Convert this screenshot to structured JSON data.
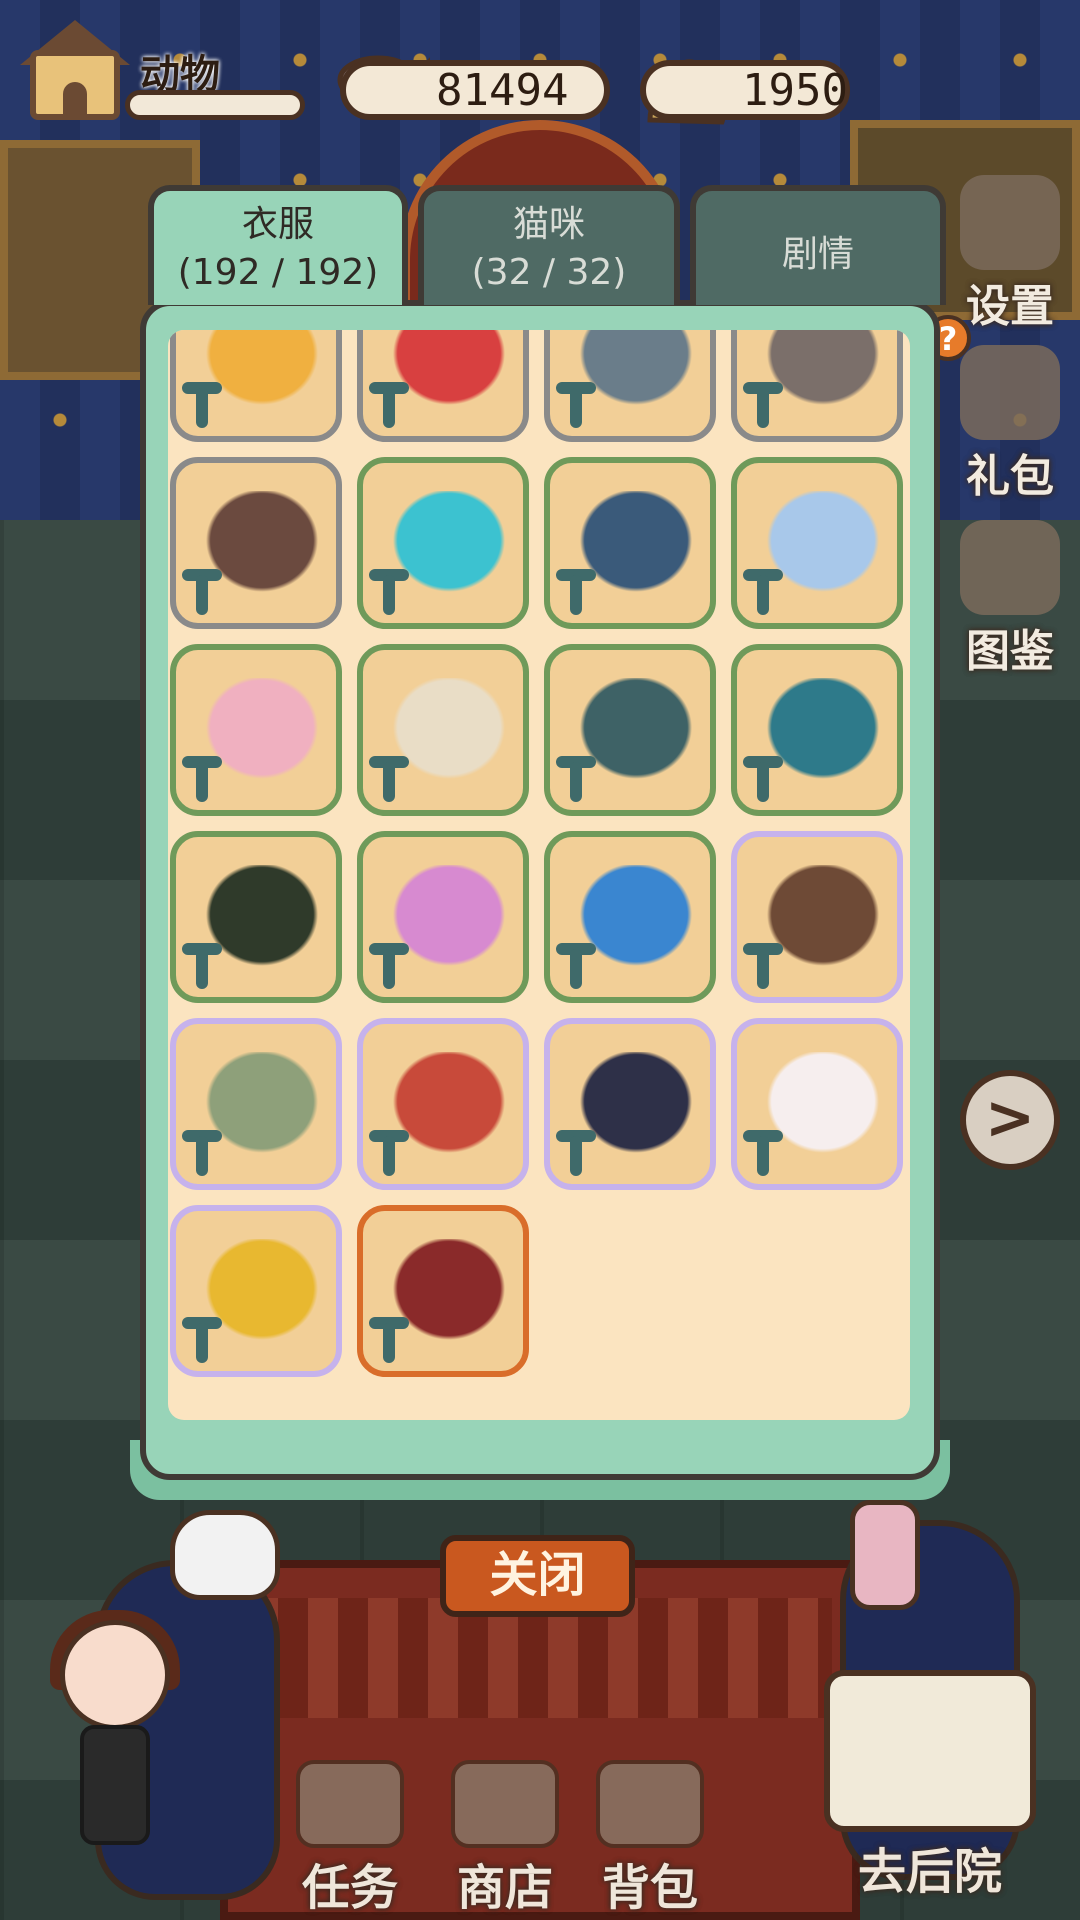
{
  "hud": {
    "home_label": "动物",
    "home_progress": 0.0,
    "fish_count": "81494",
    "coin_count": "1950"
  },
  "side_buttons": {
    "settings": "设置",
    "gift": "礼包",
    "guide": "图鉴",
    "help": "?",
    "next": ">"
  },
  "tabs": [
    {
      "label": "衣服",
      "count": "(192 / 192)"
    },
    {
      "label": "猫咪",
      "count": "(32 / 32)"
    },
    {
      "label": "剧情",
      "count": ""
    }
  ],
  "items": [
    {
      "name": "crown-outfit",
      "rarity": "gray",
      "color": "#f0b040"
    },
    {
      "name": "santa-outfit",
      "rarity": "gray",
      "color": "#d84040"
    },
    {
      "name": "helmet-outfit",
      "rarity": "gray",
      "color": "#6a7d8a"
    },
    {
      "name": "witch-hat-outfit",
      "rarity": "gray",
      "color": "#7b6f6a"
    },
    {
      "name": "cowboy-hat-outfit",
      "rarity": "gray",
      "color": "#6b4a3f"
    },
    {
      "name": "cyan-dress-outfit",
      "rarity": "green",
      "color": "#3cc2d0"
    },
    {
      "name": "navy-uniform-outfit",
      "rarity": "green",
      "color": "#3a5a7a"
    },
    {
      "name": "light-blue-outfit",
      "rarity": "green",
      "color": "#a8c8ea"
    },
    {
      "name": "pink-polka-outfit",
      "rarity": "green",
      "color": "#f0b0c0"
    },
    {
      "name": "cream-outfit",
      "rarity": "green",
      "color": "#e9ddc6"
    },
    {
      "name": "military-outfit",
      "rarity": "green",
      "color": "#3e6266"
    },
    {
      "name": "teal-jacket-outfit",
      "rarity": "green",
      "color": "#2e7a8a"
    },
    {
      "name": "striped-pants-outfit",
      "rarity": "green",
      "color": "#2f3a2a"
    },
    {
      "name": "pink-skirt-outfit",
      "rarity": "green",
      "color": "#d78ad0"
    },
    {
      "name": "blue-boots-outfit",
      "rarity": "green",
      "color": "#3a86d0"
    },
    {
      "name": "brown-cape-outfit",
      "rarity": "purple",
      "color": "#6e4a36"
    },
    {
      "name": "green-frill-outfit",
      "rarity": "purple",
      "color": "#8ea07a"
    },
    {
      "name": "red-coat-outfit",
      "rarity": "purple",
      "color": "#c84a3a"
    },
    {
      "name": "dark-armor-outfit",
      "rarity": "purple",
      "color": "#2e3048"
    },
    {
      "name": "white-tiara-outfit",
      "rarity": "purple",
      "color": "#f6eeee"
    },
    {
      "name": "yellow-horn-outfit",
      "rarity": "purple",
      "color": "#e8b830"
    },
    {
      "name": "royal-red-outfit",
      "rarity": "orange",
      "color": "#8a2a2a"
    }
  ],
  "close_label": "关闭",
  "nav": {
    "task": "任务",
    "shop": "商店",
    "bag": "背包",
    "backyard": "去后院"
  }
}
